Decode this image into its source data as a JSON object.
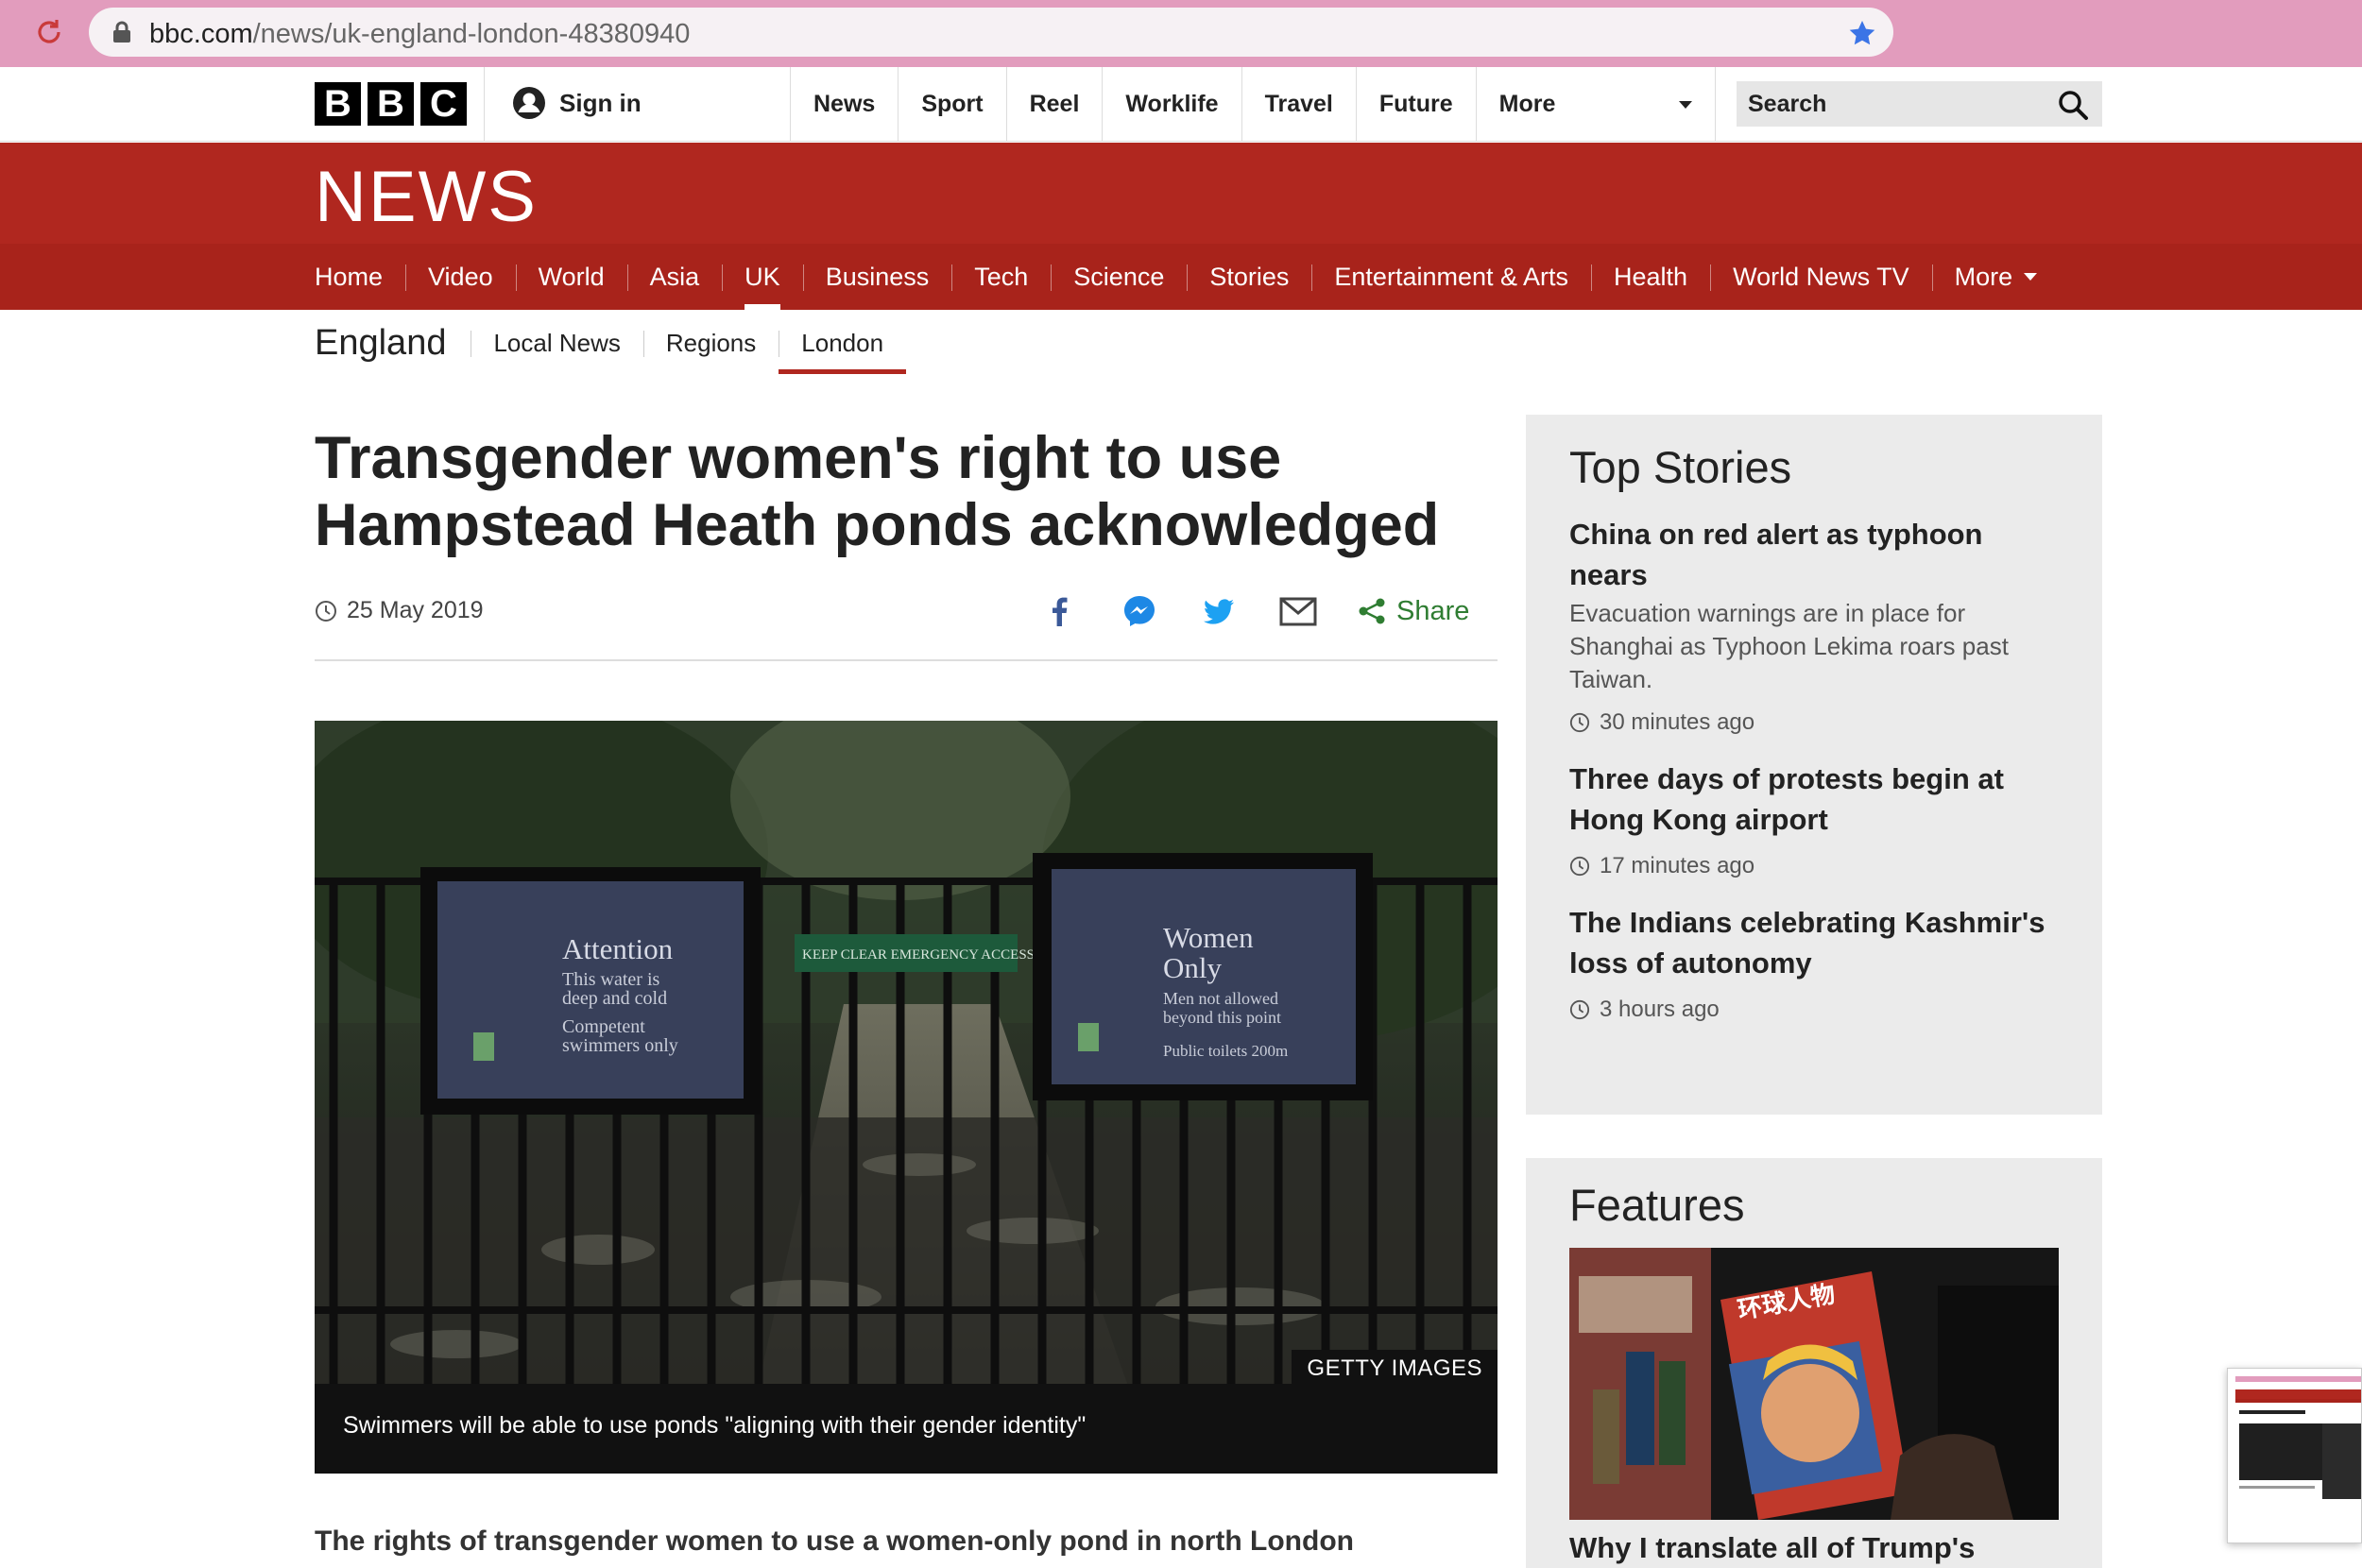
{
  "browser": {
    "url_host": "bbc.com",
    "url_path": "/news/uk-england-london-48380940"
  },
  "masthead": {
    "logo": [
      "B",
      "B",
      "C"
    ],
    "sign_in": "Sign in",
    "nav": [
      "News",
      "Sport",
      "Reel",
      "Worklife",
      "Travel",
      "Future"
    ],
    "more": "More",
    "search_placeholder": "Search"
  },
  "news_banner": {
    "wordmark": "NEWS"
  },
  "section_nav": {
    "items": [
      "Home",
      "Video",
      "World",
      "Asia",
      "UK",
      "Business",
      "Tech",
      "Science",
      "Stories",
      "Entertainment & Arts",
      "Health",
      "World News TV"
    ],
    "active": "UK",
    "more": "More"
  },
  "sub_nav": {
    "section": "England",
    "items": [
      "Local News",
      "Regions",
      "London"
    ],
    "active": "London"
  },
  "article": {
    "headline": "Transgender women's right to use Hampstead Heath ponds acknowledged",
    "date": "25 May 2019",
    "share_label": "Share",
    "image_credit": "GETTY IMAGES",
    "caption": "Swimmers will be able to use ponds \"aligning with their gender identity\"",
    "lede": "The rights of transgender women to use a women-only pond in north London",
    "sign_left": {
      "title": "Attention",
      "lines": [
        "This water is",
        "deep and cold",
        "Competent",
        "swimmers only"
      ]
    },
    "sign_middle": "KEEP CLEAR EMERGENCY ACCESS",
    "sign_right": {
      "title_1": "Women",
      "title_2": "Only",
      "lines": [
        "Men not allowed",
        "beyond this point",
        "Public toilets 200m"
      ]
    }
  },
  "top_stories": {
    "heading": "Top Stories",
    "items": [
      {
        "title": "China on red alert as typhoon nears",
        "summary": "Evacuation warnings are in place for Shanghai as Typhoon Lekima roars past Taiwan.",
        "time": "30 minutes ago"
      },
      {
        "title": "Three days of protests begin at Hong Kong airport",
        "summary": "",
        "time": "17 minutes ago"
      },
      {
        "title": "The Indians celebrating Kashmir's loss of autonomy",
        "summary": "",
        "time": "3 hours ago"
      }
    ]
  },
  "features": {
    "heading": "Features",
    "item_title": "Why I translate all of Trump's",
    "magazine_title": "环球人物"
  },
  "colors": {
    "bbc_red": "#b0271f",
    "share_green": "#2f7d32",
    "facebook_blue": "#3b5998",
    "messenger_blue": "#1e88e5",
    "twitter_blue": "#1da1f2",
    "chrome_pink": "#e29cbd"
  }
}
